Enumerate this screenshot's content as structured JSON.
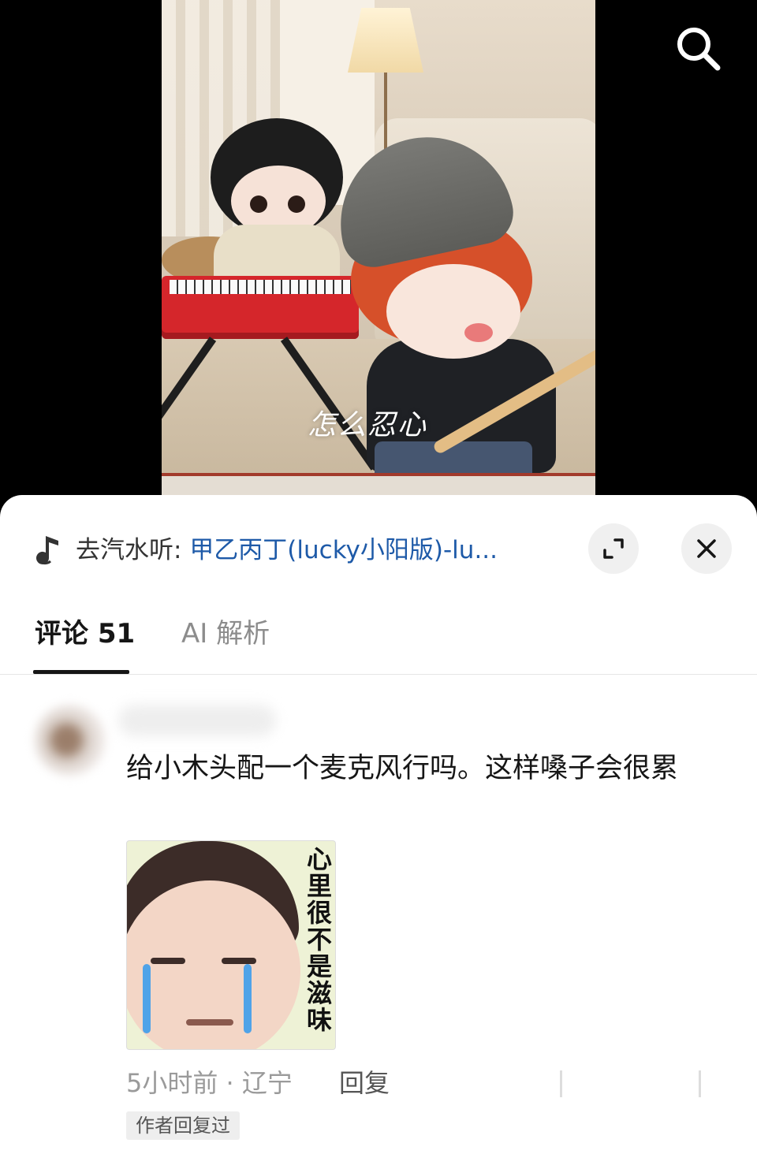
{
  "video": {
    "caption": "怎么忍心"
  },
  "header": {
    "search_icon": "search-icon"
  },
  "music_bar": {
    "prefix": "去汽水听:",
    "song": "甲乙丙丁(lucky小阳版)-lu...",
    "icons": [
      "music-note-icon",
      "expand-icon",
      "close-icon"
    ]
  },
  "tabs": [
    {
      "label": "评论 51",
      "active": true
    },
    {
      "label": "AI 解析",
      "active": false
    }
  ],
  "comment": {
    "text": "给小木头配一个麦克风行吗。这样嗓子会很累",
    "sticker_text": "心里很不是滋味",
    "time_location": "5小时前 · 辽宁",
    "reply_label": "回复",
    "author_badge": "作者回复过"
  },
  "colors": {
    "link": "#1e5aa8",
    "text_primary": "#161616",
    "text_secondary": "#9a9a9a"
  }
}
